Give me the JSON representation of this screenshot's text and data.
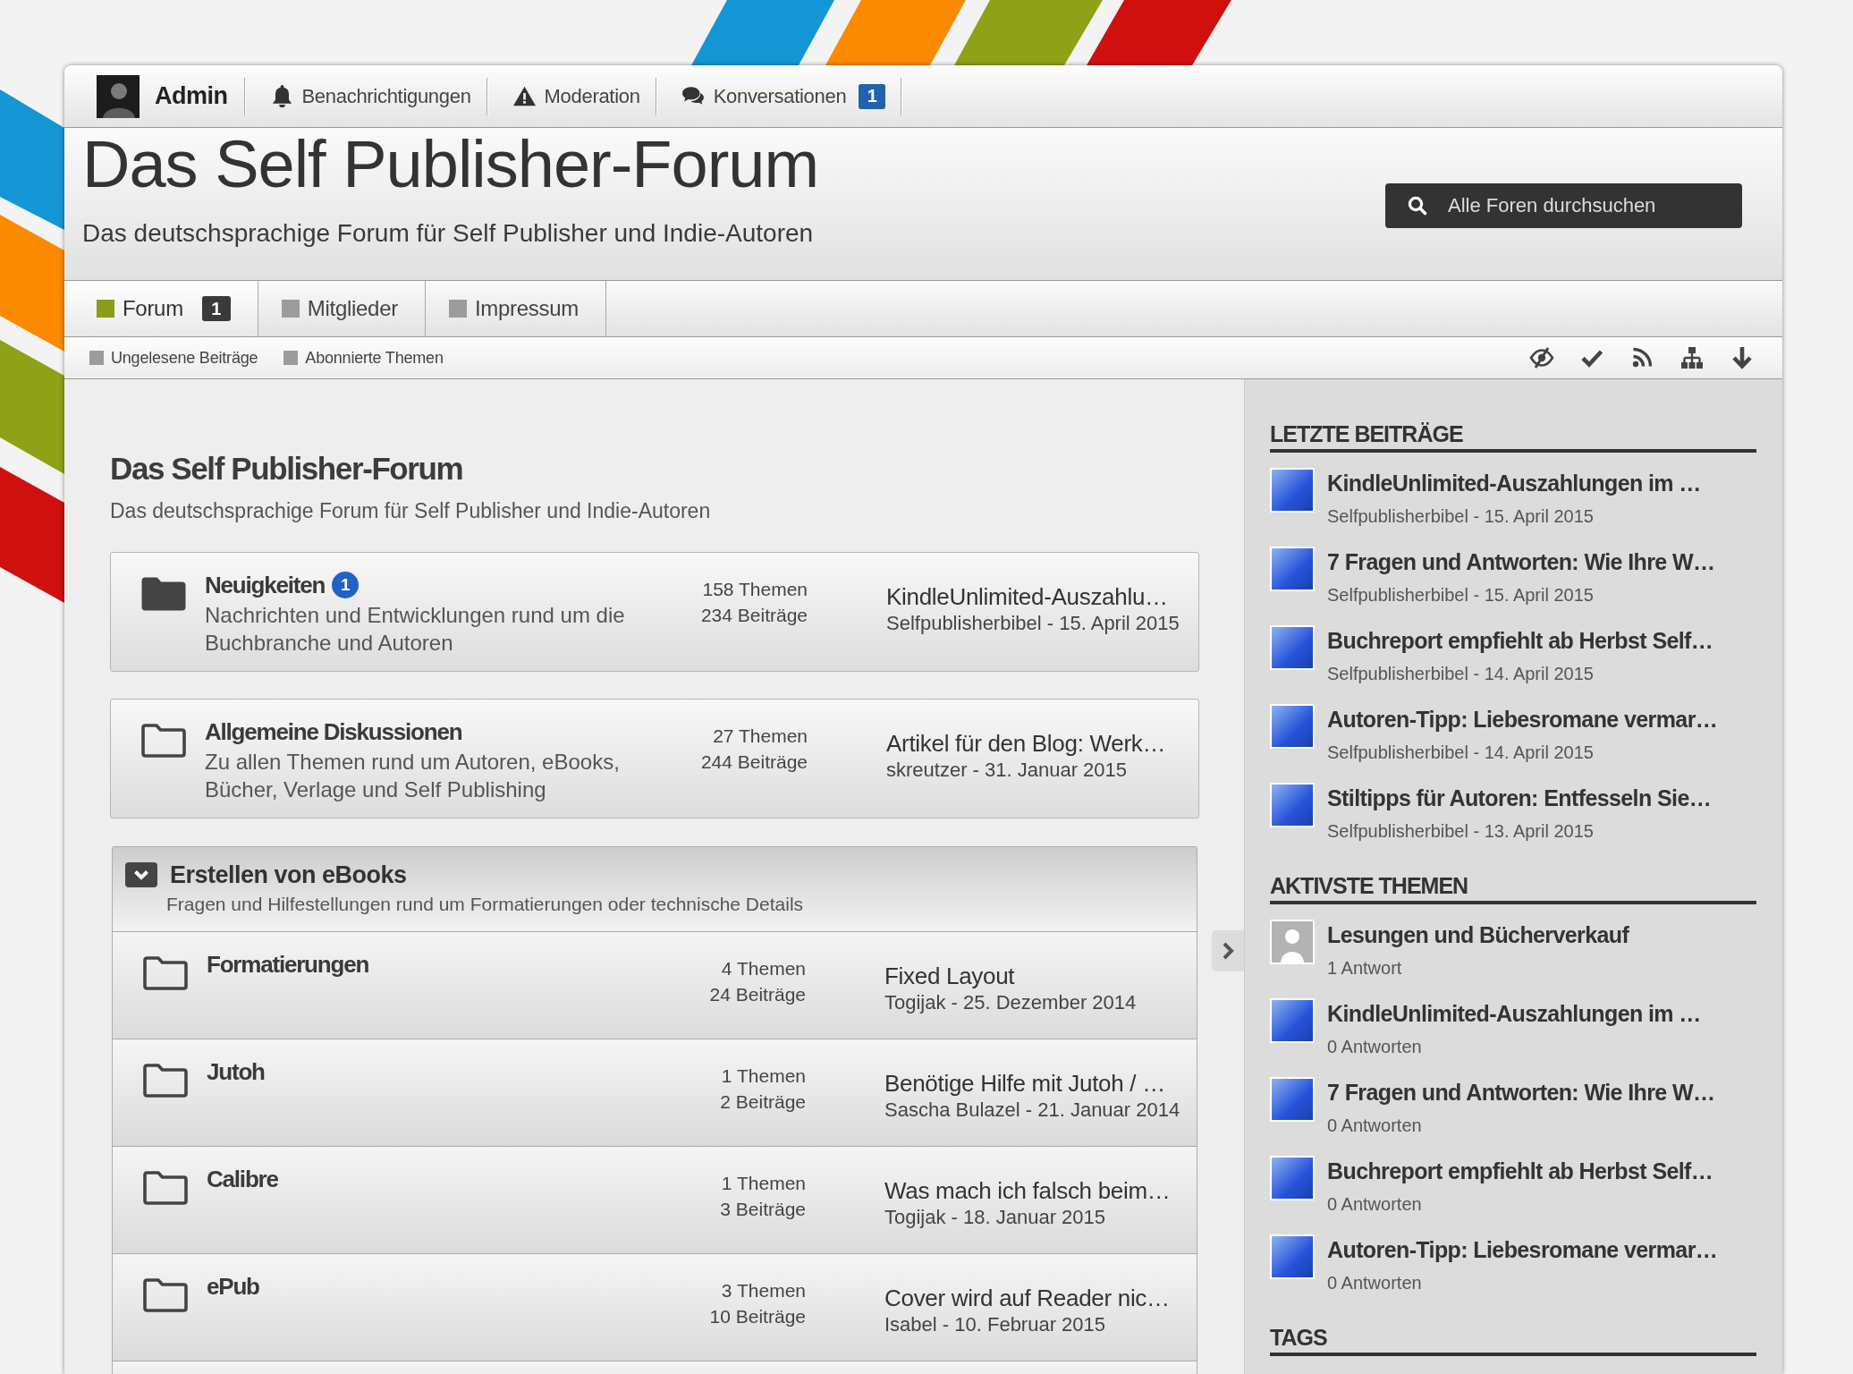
{
  "topbar": {
    "user": "Admin",
    "links": [
      {
        "label": "Benachrichtigungen"
      },
      {
        "label": "Moderation"
      },
      {
        "label": "Konversationen",
        "badge": "1"
      }
    ]
  },
  "header": {
    "title": "Das Self Publisher-Forum",
    "tagline": "Das deutschsprachige Forum für Self Publisher und Indie-Autoren",
    "search": {
      "placeholder": "Alle Foren durchsuchen"
    }
  },
  "tabs": [
    {
      "label": "Forum",
      "selected": true,
      "badge": "1"
    },
    {
      "label": "Mitglieder",
      "selected": false
    },
    {
      "label": "Impressum",
      "selected": false
    }
  ],
  "subnav": {
    "links": [
      "Ungelesene Beiträge",
      "Abonnierte Themen"
    ]
  },
  "main": {
    "title": "Das Self Publisher-Forum",
    "description": "Das deutschsprachige Forum für Self Publisher und Indie-Autoren",
    "nodes": [
      {
        "kind": "forum",
        "title": "Neuigkeiten",
        "badge": "1",
        "unread": true,
        "description": "Nachrichten und Entwicklungen rund um die Buchbranche und Autoren",
        "topics": "158 Themen",
        "posts": "234 Beiträge",
        "last_post": {
          "title": "KindleUnlimited-Auszahlu…",
          "meta": "Selfpublisherbibel - 15. April 2015"
        }
      },
      {
        "kind": "forum",
        "title": "Allgemeine Diskussionen",
        "unread": false,
        "description": "Zu allen Themen rund um Autoren, eBooks, Bücher, Verlage und Self Publishing",
        "topics": "27 Themen",
        "posts": "244 Beiträge",
        "last_post": {
          "title": "Artikel für den Blog: Werk…",
          "meta": "skreutzer - 31. Januar 2015"
        }
      },
      {
        "kind": "category",
        "title": "Erstellen von eBooks",
        "expanded": true,
        "description": "Fragen und Hilfestellungen rund um Formatierungen oder technische Details",
        "forums": [
          {
            "title": "Formatierungen",
            "unread": false,
            "topics": "4 Themen",
            "posts": "24 Beiträge",
            "last_post": {
              "title": "Fixed Layout",
              "meta": "Togijak - 25. Dezember 2014"
            }
          },
          {
            "title": "Jutoh",
            "unread": false,
            "topics": "1 Themen",
            "posts": "2 Beiträge",
            "last_post": {
              "title": "Benötige Hilfe mit Jutoh / …",
              "meta": "Sascha Bulazel - 21. Januar 2014"
            }
          },
          {
            "title": "Calibre",
            "unread": false,
            "topics": "1 Themen",
            "posts": "3 Beiträge",
            "last_post": {
              "title": "Was mach ich falsch beim…",
              "meta": "Togijak - 18. Januar 2015"
            }
          },
          {
            "title": "ePub",
            "unread": false,
            "topics": "3 Themen",
            "posts": "10 Beiträge",
            "last_post": {
              "title": "Cover wird auf Reader nic…",
              "meta": "Isabel - 10. Februar 2015"
            }
          }
        ]
      }
    ]
  },
  "sidebar": {
    "sections": [
      {
        "title": "LETZTE BEITRÄGE",
        "items": [
          {
            "kind": "photo",
            "title": "KindleUnlimited-Auszahlungen im …",
            "meta": "Selfpublisherbibel - 15. April 2015"
          },
          {
            "kind": "photo",
            "title": "7 Fragen und Antworten: Wie Ihre W…",
            "meta": "Selfpublisherbibel - 15. April 2015"
          },
          {
            "kind": "photo",
            "title": "Buchreport empfiehlt ab Herbst Self…",
            "meta": "Selfpublisherbibel - 14. April 2015"
          },
          {
            "kind": "photo",
            "title": "Autoren-Tipp: Liebesromane vermar…",
            "meta": "Selfpublisherbibel - 14. April 2015"
          },
          {
            "kind": "photo",
            "title": "Stiltipps für Autoren: Entfesseln Sie…",
            "meta": "Selfpublisherbibel - 13. April 2015"
          }
        ]
      },
      {
        "title": "AKTIVSTE THEMEN",
        "items": [
          {
            "kind": "default",
            "title": "Lesungen und Bücherverkauf",
            "meta": "1 Antwort"
          },
          {
            "kind": "photo",
            "title": "KindleUnlimited-Auszahlungen im …",
            "meta": "0 Antworten"
          },
          {
            "kind": "photo",
            "title": "7 Fragen und Antworten: Wie Ihre W…",
            "meta": "0 Antworten"
          },
          {
            "kind": "photo",
            "title": "Buchreport empfiehlt ab Herbst Self…",
            "meta": "0 Antworten"
          },
          {
            "kind": "photo",
            "title": "Autoren-Tipp: Liebesromane vermar…",
            "meta": "0 Antworten"
          }
        ]
      },
      {
        "title": "TAGS"
      }
    ]
  }
}
